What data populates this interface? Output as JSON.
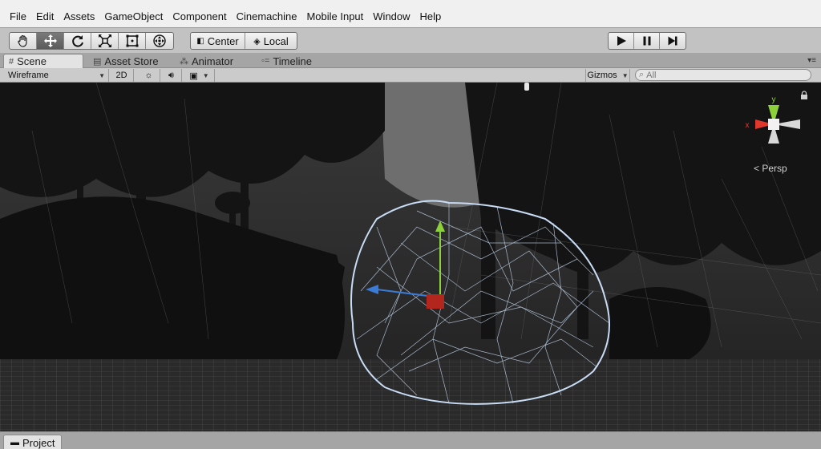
{
  "menu": [
    "File",
    "Edit",
    "Assets",
    "GameObject",
    "Component",
    "Cinemachine",
    "Mobile Input",
    "Window",
    "Help"
  ],
  "toolbar": {
    "tools": [
      "hand-icon",
      "move-icon",
      "rotate-icon",
      "scale-icon",
      "rect-icon",
      "transform-icon"
    ],
    "active_tool": "move-icon",
    "pivot_label": "Center",
    "space_label": "Local",
    "play_controls": [
      "play-icon",
      "pause-icon",
      "step-icon"
    ]
  },
  "tabs": [
    {
      "label": "Scene",
      "icon": "grid-icon",
      "active": true
    },
    {
      "label": "Asset Store",
      "icon": "store-icon",
      "active": false
    },
    {
      "label": "Animator",
      "icon": "animator-icon",
      "active": false
    },
    {
      "label": "Timeline",
      "icon": "timeline-icon",
      "active": false
    }
  ],
  "scene_toolbar": {
    "shading_mode": "Wireframe",
    "mode_2d": "2D",
    "gizmos_label": "Gizmos",
    "search_placeholder": "All"
  },
  "viewport": {
    "projection_label": "Persp",
    "gizmo_axes": {
      "x": "x",
      "y": "y"
    },
    "colors": {
      "x_axis": "#e0392b",
      "y_axis": "#8cd13a",
      "z_axis": "#3a7bd5",
      "wire": "#c8dcf5"
    }
  },
  "bottom": {
    "project_label": "Project"
  }
}
